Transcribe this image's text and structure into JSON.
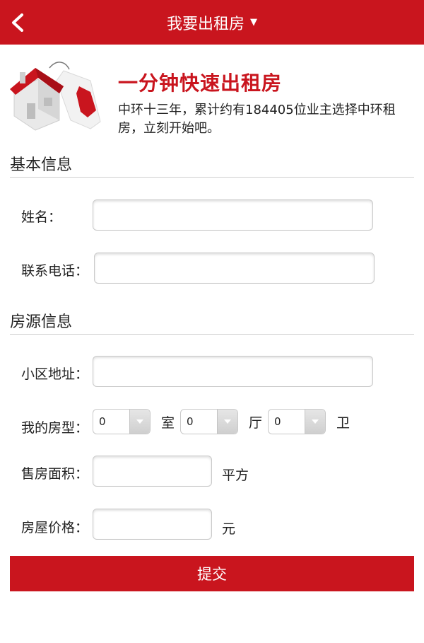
{
  "header": {
    "title": "我要出租房",
    "back_icon": "chevron-left-icon",
    "title_caret_icon": "caret-down-icon",
    "background_color": "#c9151e"
  },
  "intro": {
    "icon": "house-with-tag-icon",
    "heading": "一分钟快速出租房",
    "description": "中环十三年，累计约有184405位业主选择中环租房，立刻开始吧。"
  },
  "sections": {
    "basic_info": {
      "title": "基本信息",
      "name_label": "姓名：",
      "name_value": "",
      "phone_label": "联系电话：",
      "phone_value": ""
    },
    "property_info": {
      "title": "房源信息",
      "address_label": "小区地址：",
      "address_value": "",
      "layout_label": "我的房型：",
      "rooms_value": "0",
      "rooms_unit": "室",
      "halls_value": "0",
      "halls_unit": "厅",
      "baths_value": "0",
      "baths_unit": "卫",
      "area_label": "售房面积：",
      "area_value": "",
      "area_unit": "平方",
      "price_label": "房屋价格：",
      "price_value": "",
      "price_unit": "元"
    }
  },
  "submit": {
    "label": "提交"
  }
}
